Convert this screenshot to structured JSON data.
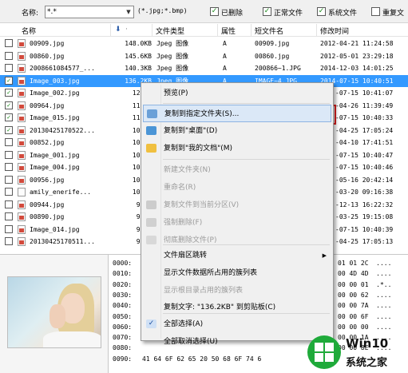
{
  "filter": {
    "name_label": "名称:",
    "name_value": "*.*",
    "type_hint": "(*.jpg;*.bmp)",
    "checks": [
      {
        "label": "已删除",
        "checked": true
      },
      {
        "label": "正常文件",
        "checked": true
      },
      {
        "label": "系统文件",
        "checked": true
      },
      {
        "label": "重复文",
        "checked": false
      }
    ]
  },
  "columns": [
    "名称",
    "",
    "文件类型",
    "属性",
    "短文件名",
    "修改时间"
  ],
  "size_col_icon": "download-arrow-icon",
  "rows": [
    {
      "checked": false,
      "name": "00909.jpg",
      "size": "148.0KB",
      "type": "Jpeg 图像",
      "attr": "A",
      "short": "00909.jpg",
      "mtime": "2012-04-21 11:24:58",
      "selected": false
    },
    {
      "checked": false,
      "name": "00860.jpg",
      "size": "145.6KB",
      "type": "Jpeg 图像",
      "attr": "A",
      "short": "00860.jpg",
      "mtime": "2012-05-01 23:29:18",
      "selected": false
    },
    {
      "checked": false,
      "name": "2008661084577_...",
      "size": "140.3KB",
      "type": "Jpeg 图像",
      "attr": "A",
      "short": "200866~1.JPG",
      "mtime": "2014-12-03 14:01:25",
      "selected": false
    },
    {
      "checked": true,
      "name": "Image_003.jpg",
      "size": "136.2KB",
      "type": "Jpeg 图像",
      "attr": "A",
      "short": "IMAGE~4.JPG",
      "mtime": "2014-07-15 10:40:51",
      "selected": true
    },
    {
      "checked": true,
      "name": "Image_002.jpg",
      "size": "127.3",
      "type": "",
      "attr": "",
      "short": "",
      "mtime": "-07-15 10:41:07",
      "selected": false
    },
    {
      "checked": true,
      "name": "00964.jpg",
      "size": "118.4",
      "type": "",
      "attr": "",
      "short": "",
      "mtime": "-04-26 11:39:49",
      "selected": false
    },
    {
      "checked": true,
      "name": "Image_015.jpg",
      "size": "113.9",
      "type": "",
      "attr": "",
      "short": "",
      "mtime": "-07-15 10:40:33",
      "selected": false
    },
    {
      "checked": true,
      "name": "20130425170522...",
      "size": "109.1",
      "type": "",
      "attr": "",
      "short": "",
      "mtime": "-04-25 17:05:24",
      "selected": false
    },
    {
      "checked": false,
      "name": "00852.jpg",
      "size": "108.2",
      "type": "",
      "attr": "",
      "short": "",
      "mtime": "-04-10 17:41:51",
      "selected": false
    },
    {
      "checked": false,
      "name": "Image_001.jpg",
      "size": "107.7",
      "type": "",
      "attr": "",
      "short": "",
      "mtime": "-07-15 10:40:47",
      "selected": false
    },
    {
      "checked": false,
      "name": "Image_004.jpg",
      "size": "107.1",
      "type": "",
      "attr": "",
      "short": "",
      "mtime": "-07-15 10:40:46",
      "selected": false
    },
    {
      "checked": false,
      "name": "00956.jpg",
      "size": "104.8",
      "type": "",
      "attr": "",
      "short": "",
      "mtime": "-05-16 20:42:14",
      "selected": false
    },
    {
      "checked": false,
      "name": "amily_enerife...",
      "size": "100.5",
      "type": "",
      "attr": "",
      "short": "",
      "mtime": "-03-20 09:16:38",
      "selected": false,
      "blank_icon": true
    },
    {
      "checked": false,
      "name": "00944.jpg",
      "size": "99.5",
      "type": "",
      "attr": "",
      "short": "",
      "mtime": "-12-13 16:22:32",
      "selected": false
    },
    {
      "checked": false,
      "name": "00890.jpg",
      "size": "99.5",
      "type": "",
      "attr": "",
      "short": "",
      "mtime": "-03-25 19:15:08",
      "selected": false
    },
    {
      "checked": false,
      "name": "Image_014.jpg",
      "size": "96.2",
      "type": "",
      "attr": "",
      "short": "",
      "mtime": "-07-15 10:40:39",
      "selected": false
    },
    {
      "checked": false,
      "name": "20130425170511...",
      "size": "95.3",
      "type": "",
      "attr": "",
      "short": "",
      "mtime": "-04-25 17:05:13",
      "selected": false
    }
  ],
  "hex": {
    "lines": [
      {
        "offset": "0000:",
        "right": "01 01 2C  ...."
      },
      {
        "offset": "0010:",
        "right": "00 4D 4D  ...."
      },
      {
        "offset": "0020:",
        "right": "00 00 01  .*.."
      },
      {
        "offset": "0030:",
        "right": "00 00 62  ...."
      },
      {
        "offset": "0040:",
        "right": "00 00 7A  ...."
      },
      {
        "offset": "0050:",
        "right": "00 00 6F  ...."
      },
      {
        "offset": "0060:",
        "right": "00 00 00  ...."
      },
      {
        "offset": "0070:",
        "right": "00 00 1A  ...."
      },
      {
        "offset": "0080:",
        "right": "00 00 8E  ...."
      },
      {
        "offset": "0090:",
        "right": "",
        "bytes": "41 64 6F 62 65 20 50 68 6F 74 6"
      }
    ]
  },
  "menu": {
    "items": [
      {
        "label": "预览(P)",
        "disabled": false,
        "icon": "",
        "highlighted": false
      },
      {
        "label": "复制到指定文件夹(S)...",
        "disabled": false,
        "icon": "copy-to-folder-icon",
        "highlighted": true
      },
      {
        "label": "复制到\"桌面\"(D)",
        "disabled": false,
        "icon": "desktop-icon",
        "highlighted": false
      },
      {
        "label": "复制到\"我的文档\"(M)",
        "disabled": false,
        "icon": "folder-icon",
        "highlighted": false
      },
      {
        "label": "新建文件夹(N)",
        "disabled": true,
        "icon": "",
        "highlighted": false
      },
      {
        "label": "重命名(R)",
        "disabled": true,
        "icon": "",
        "highlighted": false
      },
      {
        "label": "复制文件到当前分区(V)",
        "disabled": true,
        "icon": "copy-partition-icon",
        "highlighted": false
      },
      {
        "label": "强制删除(F)",
        "disabled": true,
        "icon": "force-delete-icon",
        "highlighted": false
      },
      {
        "label": "彻底删除文件(P)",
        "disabled": true,
        "icon": "wipe-icon",
        "highlighted": false
      },
      {
        "label": "文件扇区跳转",
        "disabled": false,
        "icon": "",
        "highlighted": false,
        "submenu": true
      },
      {
        "label": "显示文件数据所占用的簇列表",
        "disabled": false,
        "icon": "",
        "highlighted": false
      },
      {
        "label": "显示根目录占用的簇列表",
        "disabled": true,
        "icon": "",
        "highlighted": false
      },
      {
        "label": "复制文字: \"136.2KB\" 到剪贴板(C)",
        "disabled": false,
        "icon": "",
        "highlighted": false
      },
      {
        "label": "全部选择(A)",
        "disabled": false,
        "icon": "check-icon",
        "highlighted": false
      },
      {
        "label": "全部取消选择(U)",
        "disabled": false,
        "icon": "",
        "highlighted": false
      }
    ]
  },
  "watermark": {
    "line1": "Win10",
    "line2": "系统之家"
  },
  "colors": {
    "selection": "#3399ff",
    "highlight_box": "#e02020",
    "logo": "#1faa3a"
  }
}
